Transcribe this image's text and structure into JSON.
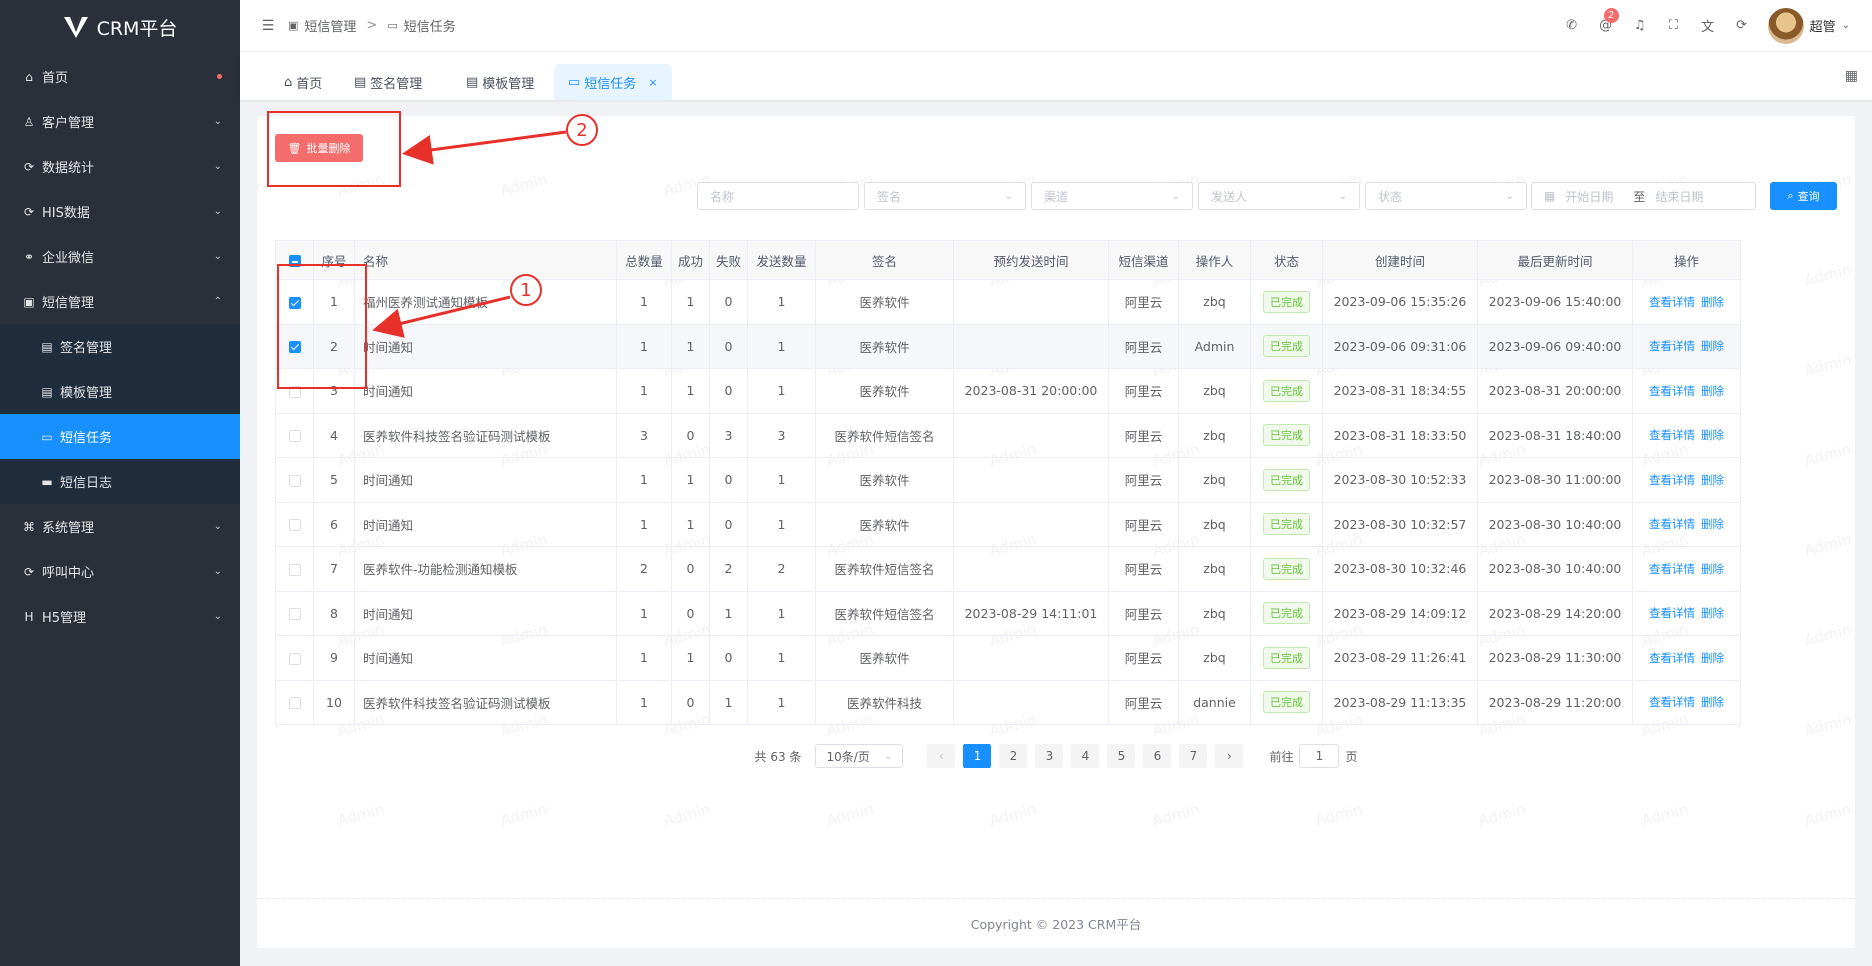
{
  "brand": {
    "title": "CRM平台"
  },
  "sidebar": {
    "items": [
      {
        "label": "首页",
        "icon": "home-icon",
        "glyph": "⌂",
        "dot": true
      },
      {
        "label": "客户管理",
        "icon": "user-icon",
        "glyph": "♙",
        "chevron": "⌄"
      },
      {
        "label": "数据统计",
        "icon": "chart-icon",
        "glyph": "⟳",
        "chevron": "⌄"
      },
      {
        "label": "HIS数据",
        "icon": "data-icon",
        "glyph": "⟳",
        "chevron": "⌄"
      },
      {
        "label": "企业微信",
        "icon": "wechat-icon",
        "glyph": "⚭",
        "chevron": "⌄"
      },
      {
        "label": "短信管理",
        "icon": "sms-icon",
        "glyph": "▣",
        "chevron": "⌃"
      },
      {
        "label": "签名管理",
        "icon": "signature-icon",
        "glyph": "▤",
        "sub": true
      },
      {
        "label": "模板管理",
        "icon": "template-icon",
        "glyph": "▤",
        "sub": true
      },
      {
        "label": "短信任务",
        "icon": "message-icon",
        "glyph": "▭",
        "sub": true,
        "active": true
      },
      {
        "label": "短信日志",
        "icon": "log-icon",
        "glyph": "▬",
        "sub": true
      },
      {
        "label": "系统管理",
        "icon": "system-icon",
        "glyph": "⌘",
        "chevron": "⌄"
      },
      {
        "label": "呼叫中心",
        "icon": "call-center-icon",
        "glyph": "⟳",
        "chevron": "⌄"
      },
      {
        "label": "H5管理",
        "icon": "h5-icon",
        "glyph": "H",
        "chevron": "⌄"
      }
    ]
  },
  "header": {
    "breadcrumb": [
      "短信管理",
      "短信任务"
    ],
    "separator": ">",
    "notification_count": "2",
    "username": "超管",
    "username_suffix": "⌄"
  },
  "tabs": [
    {
      "label": "首页",
      "glyph": "⌂"
    },
    {
      "label": "签名管理",
      "glyph": "▤"
    },
    {
      "label": "模板管理",
      "glyph": "▤"
    },
    {
      "label": "短信任务",
      "glyph": "▭",
      "active": true,
      "close": "×"
    }
  ],
  "toolbar": {
    "batch_delete_label": "批量删除"
  },
  "filters": {
    "name_placeholder": "名称",
    "signature_placeholder": "签名",
    "channel_placeholder": "渠道",
    "sender_placeholder": "发送人",
    "status_placeholder": "状态",
    "start_date_placeholder": "开始日期",
    "date_separator": "至",
    "end_date_placeholder": "结束日期",
    "search_label": "查询"
  },
  "table": {
    "headers": [
      "序号",
      "名称",
      "总数量",
      "成功",
      "失败",
      "发送数量",
      "签名",
      "预约发送时间",
      "短信渠道",
      "操作人",
      "状态",
      "创建时间",
      "最后更新时间",
      "操作"
    ],
    "rows": [
      {
        "checked": true,
        "no": "1",
        "name": "福州医养测试通知模板",
        "total": "1",
        "success": "1",
        "fail": "0",
        "sent": "1",
        "signature": "医养软件",
        "scheduled": "",
        "channel": "阿里云",
        "operator": "zbq",
        "status": "已完成",
        "created": "2023-09-06 15:35:26",
        "updated": "2023-09-06 15:40:00"
      },
      {
        "checked": true,
        "no": "2",
        "name": "时间通知",
        "total": "1",
        "success": "1",
        "fail": "0",
        "sent": "1",
        "signature": "医养软件",
        "scheduled": "",
        "channel": "阿里云",
        "operator": "Admin",
        "status": "已完成",
        "created": "2023-09-06 09:31:06",
        "updated": "2023-09-06 09:40:00"
      },
      {
        "checked": false,
        "no": "3",
        "name": "时间通知",
        "total": "1",
        "success": "1",
        "fail": "0",
        "sent": "1",
        "signature": "医养软件",
        "scheduled": "2023-08-31 20:00:00",
        "channel": "阿里云",
        "operator": "zbq",
        "status": "已完成",
        "created": "2023-08-31 18:34:55",
        "updated": "2023-08-31 20:00:00"
      },
      {
        "checked": false,
        "no": "4",
        "name": "医养软件科技签名验证码测试模板",
        "total": "3",
        "success": "0",
        "fail": "3",
        "sent": "3",
        "signature": "医养软件短信签名",
        "scheduled": "",
        "channel": "阿里云",
        "operator": "zbq",
        "status": "已完成",
        "created": "2023-08-31 18:33:50",
        "updated": "2023-08-31 18:40:00"
      },
      {
        "checked": false,
        "no": "5",
        "name": "时间通知",
        "total": "1",
        "success": "1",
        "fail": "0",
        "sent": "1",
        "signature": "医养软件",
        "scheduled": "",
        "channel": "阿里云",
        "operator": "zbq",
        "status": "已完成",
        "created": "2023-08-30 10:52:33",
        "updated": "2023-08-30 11:00:00"
      },
      {
        "checked": false,
        "no": "6",
        "name": "时间通知",
        "total": "1",
        "success": "1",
        "fail": "0",
        "sent": "1",
        "signature": "医养软件",
        "scheduled": "",
        "channel": "阿里云",
        "operator": "zbq",
        "status": "已完成",
        "created": "2023-08-30 10:32:57",
        "updated": "2023-08-30 10:40:00"
      },
      {
        "checked": false,
        "no": "7",
        "name": "医养软件-功能检测通知模板",
        "total": "2",
        "success": "0",
        "fail": "2",
        "sent": "2",
        "signature": "医养软件短信签名",
        "scheduled": "",
        "channel": "阿里云",
        "operator": "zbq",
        "status": "已完成",
        "created": "2023-08-30 10:32:46",
        "updated": "2023-08-30 10:40:00"
      },
      {
        "checked": false,
        "no": "8",
        "name": "时间通知",
        "total": "1",
        "success": "0",
        "fail": "1",
        "sent": "1",
        "signature": "医养软件短信签名",
        "scheduled": "2023-08-29 14:11:01",
        "channel": "阿里云",
        "operator": "zbq",
        "status": "已完成",
        "created": "2023-08-29 14:09:12",
        "updated": "2023-08-29 14:20:00"
      },
      {
        "checked": false,
        "no": "9",
        "name": "时间通知",
        "total": "1",
        "success": "1",
        "fail": "0",
        "sent": "1",
        "signature": "医养软件",
        "scheduled": "",
        "channel": "阿里云",
        "operator": "zbq",
        "status": "已完成",
        "created": "2023-08-29 11:26:41",
        "updated": "2023-08-29 11:30:00"
      },
      {
        "checked": false,
        "no": "10",
        "name": "医养软件科技签名验证码测试模板",
        "total": "1",
        "success": "0",
        "fail": "1",
        "sent": "1",
        "signature": "医养软件科技",
        "scheduled": "",
        "channel": "阿里云",
        "operator": "dannie",
        "status": "已完成",
        "created": "2023-08-29 11:13:35",
        "updated": "2023-08-29 11:20:00"
      }
    ],
    "action_view": "查看详情",
    "action_delete": "删除"
  },
  "pagination": {
    "total_label": "共 63 条",
    "page_size": "10条/页",
    "pages": [
      "1",
      "2",
      "3",
      "4",
      "5",
      "6",
      "7"
    ],
    "current_page": "1",
    "prev": "‹",
    "next": "›",
    "goto_label": "前往",
    "goto_value": "1",
    "goto_suffix": "页"
  },
  "footer": {
    "copyright": "Copyright © 2023 CRM平台"
  },
  "annotations": {
    "label_1": "1",
    "label_2": "2"
  },
  "watermark": {
    "text": "Admin"
  },
  "colors": {
    "sidebar_bg": "#2b2f3a",
    "primary": "#1890ff",
    "danger": "#f56c6c",
    "success": "#67c23a",
    "annotation": "#e8302a"
  }
}
